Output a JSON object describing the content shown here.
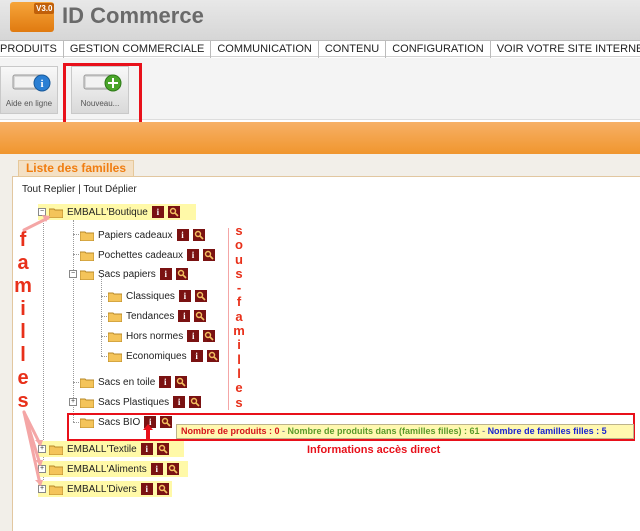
{
  "app": {
    "logo_version": "V3.0",
    "title": "ID Commerce"
  },
  "menu": [
    {
      "label": "PRODUITS"
    },
    {
      "label": "GESTION COMMERCIALE"
    },
    {
      "label": "COMMUNICATION"
    },
    {
      "label": "CONTENU"
    },
    {
      "label": "CONFIGURATION"
    },
    {
      "label": "VOIR VOTRE SITE INTERNET"
    }
  ],
  "toolbar": {
    "help_label": "Aide en ligne",
    "new_label": "Nouveau..."
  },
  "panel": {
    "title": "Liste des familles",
    "collapse_all": "Tout Replier",
    "separator": "|",
    "expand_all": "Tout Déplier"
  },
  "tree": {
    "boutique": "EMBALL'Boutique",
    "papiers_cadeaux": "Papiers cadeaux",
    "pochettes_cadeaux": "Pochettes cadeaux",
    "sacs_papiers": "Sacs papiers",
    "classiques": "Classiques",
    "tendances": "Tendances",
    "hors_normes": "Hors normes",
    "economiques": "Economiques",
    "sacs_toile": "Sacs en toile",
    "sacs_plastiques": "Sacs Plastiques",
    "sacs_bio": "Sacs BIO",
    "textile": "EMBALL'Textile",
    "aliments": "EMBALL'Aliments",
    "divers": "EMBALL'Divers",
    "info_icon_glyph": "i"
  },
  "info": {
    "produits": "Nombre de produits : 0",
    "sep": " - ",
    "produits_filles": "Nombre de produits dans (familles filles) : 61",
    "familles_filles": "Nombre de familles filles : 5",
    "access_label": "Informations accès direct"
  },
  "annotations": {
    "familles_letters": [
      "f",
      "a",
      "m",
      "i",
      "l",
      "l",
      "e",
      "s"
    ],
    "sous_familles_letters": [
      "s",
      "o",
      "u",
      "s",
      "-",
      "f",
      "a",
      "m",
      "i",
      "l",
      "l",
      "e",
      "s"
    ]
  },
  "colors": {
    "accent_orange": "#f0962e",
    "highlight_red": "#e8101a",
    "info_red": "#d4141a",
    "info_green": "#5a9a2a",
    "info_blue": "#1a26d0",
    "row_highlight": "#fff9a8"
  },
  "icons": {
    "search_button": "magnifier-icon",
    "info_button": "info-icon",
    "folder": "folder-icon"
  }
}
